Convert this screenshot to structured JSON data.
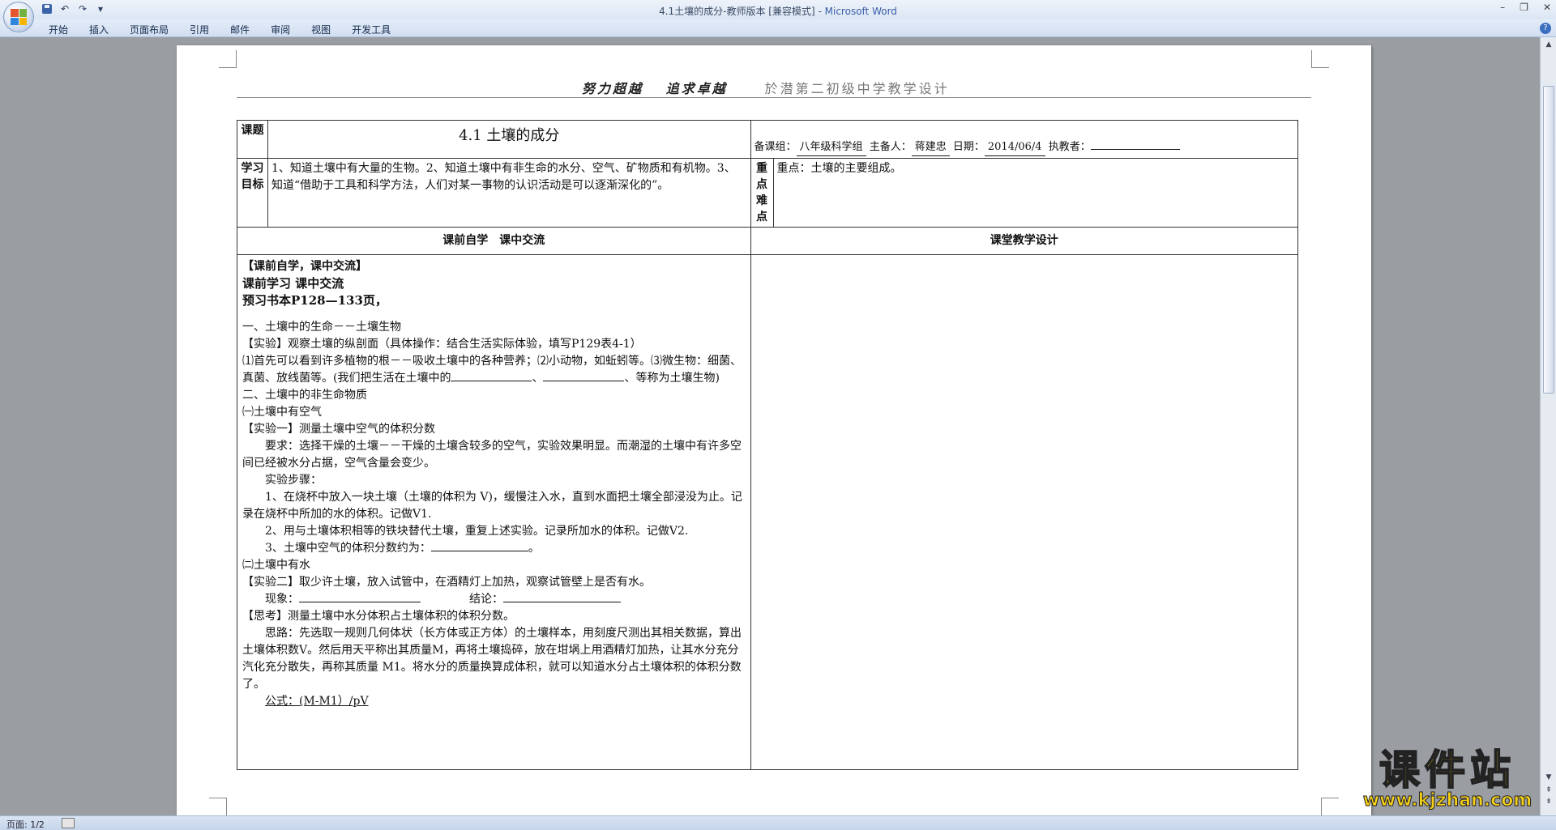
{
  "window": {
    "title_doc": "4.1土壤的成分-教师版本 [兼容模式] - ",
    "title_app": "Microsoft Word"
  },
  "ribbon": {
    "tabs": [
      "开始",
      "插入",
      "页面布局",
      "引用",
      "邮件",
      "审阅",
      "视图",
      "开发工具"
    ]
  },
  "page_header": {
    "motto": "努力超越　 追求卓越",
    "school": "於潜第二初级中学教学设计"
  },
  "table": {
    "topic_label": "课题",
    "lesson_title": "4.1 土壤的成分",
    "prep_group_label": "备课组：",
    "prep_group": "八年级科学组",
    "lead_label": "主备人：",
    "lead": "蒋建忠",
    "date_label": "日期：",
    "date": "2014/06/4",
    "teacher_label": "执教者：",
    "teacher": "",
    "goals_label": "学习目标",
    "goals": "1、知道土壤中有大量的生物。2、知道土壤中有非生命的水分、空气、矿物质和有机物。3、知道“借助于工具和科学方法，人们对某一事物的认识活动是可以逐渐深化的”。",
    "key_label": "重点难点",
    "key": "重点：土壤的主要组成。",
    "col_left_head": "课前自学　课中交流",
    "col_right_head": "课堂教学设计"
  },
  "content": {
    "l1": "【课前自学，课中交流】",
    "l2": "课前学习 课中交流",
    "l3": "预习书本P128—133页，",
    "l4": "一、土壤中的生命－－土壤生物",
    "l5": "【实验】观察土壤的纵剖面（具体操作：结合生活实际体验，填写P129表4-1）",
    "l6a": "⑴首先可以看到许多植物的根－－吸收土壤中的各种营养；⑵小动物，如蚯蚓等。⑶微生物：细菌、真菌、放线菌等。(我们把生活在土壤中的",
    "l6b": "、",
    "l6c": "、等称为土壤生物)",
    "l7": "二、土壤中的非生命物质",
    "l8": "㈠土壤中有空气",
    "l9": "【实验一】测量土壤中空气的体积分数",
    "l10": "要求：选择干燥的土壤－－干燥的土壤含较多的空气，实验效果明显。而潮湿的土壤中有许多空间已经被水分占据，空气含量会变少。",
    "l11": "实验步骤：",
    "l12": "1、在烧杯中放入一块土壤（土壤的体积为 V)，缓慢注入水，直到水面把土壤全部浸没为止。记录在烧杯中所加的水的体积。记做V1.",
    "l13": "2、用与土壤体积相等的铁块替代土壤，重复上述实验。记录所加水的体积。记做V2.",
    "l14a": "3、土壤中空气的体积分数约为：",
    "l14b": "。",
    "l15": "㈡土壤中有水",
    "l16": "【实验二】取少许土壤，放入试管中，在酒精灯上加热，观察试管壁上是否有水。",
    "l17a": "现象：",
    "l17b": "结论：",
    "l18": "【思考】测量土壤中水分体积占土壤体积的体积分数。",
    "l19": "思路：先选取一规则几何体状（长方体或正方体）的土壤样本，用刻度尺测出其相关数据，算出土壤体积数V。然后用天平称出其质量M，再将土壤捣碎，放在坩埚上用酒精灯加热，让其水分充分汽化充分散失，再称其质量 M1。将水分的质量换算成体积，就可以知道水分占土壤体积的体积分数了。",
    "l20": "公式：(M-M1）/pV"
  },
  "status": {
    "page": "页面: 1/2"
  },
  "watermark": {
    "cn": "课件站",
    "url": "www.kjzhan.com"
  }
}
